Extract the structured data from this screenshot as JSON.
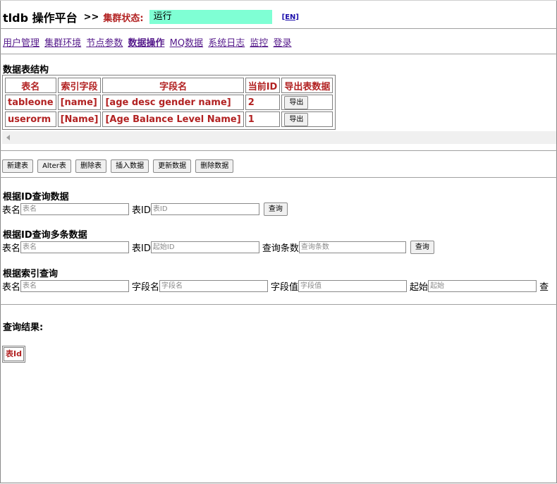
{
  "header": {
    "brand": "tldb 操作平台",
    "separator": ">>",
    "status_label": "集群状态:",
    "status_value": "运行",
    "lang_link": "[EN]"
  },
  "nav": {
    "items": [
      {
        "label": "用户管理"
      },
      {
        "label": "集群环境"
      },
      {
        "label": "节点参数"
      },
      {
        "label": "数据操作"
      },
      {
        "label": "MQ数据"
      },
      {
        "label": "系统日志"
      },
      {
        "label": "监控"
      },
      {
        "label": "登录"
      }
    ]
  },
  "structure": {
    "title": "数据表结构",
    "columns": [
      "表名",
      "索引字段",
      "字段名",
      "当前ID",
      "导出表数据"
    ],
    "rows": [
      {
        "table": "tableone",
        "index": "[name]",
        "fields": "[age desc gender name]",
        "current_id": "2",
        "export_label": "导出"
      },
      {
        "table": "userorm",
        "index": "[Name]",
        "fields": "[Age Balance Level Name]",
        "current_id": "1",
        "export_label": "导出"
      }
    ]
  },
  "actions": {
    "new_table": "新建表",
    "alter_table": "Alter表",
    "delete_table": "删除表",
    "insert_data": "插入数据",
    "update_data": "更新数据",
    "delete_data": "删除数据"
  },
  "query_by_id": {
    "title": "根据ID查询数据",
    "table_label": "表名",
    "table_placeholder": "表名",
    "id_label": "表ID",
    "id_placeholder": "表ID",
    "button": "查询"
  },
  "query_multi": {
    "title": "根据ID查询多条数据",
    "table_label": "表名",
    "table_placeholder": "表名",
    "id_label": "表ID",
    "id_placeholder": "起始ID",
    "count_label": "查询条数",
    "count_placeholder": "查询条数",
    "button": "查询"
  },
  "query_index": {
    "title": "根据索引查询",
    "table_label": "表名",
    "table_placeholder": "表名",
    "field_label": "字段名",
    "field_placeholder": "字段名",
    "value_label": "字段值",
    "value_placeholder": "字段值",
    "start_label": "起始",
    "start_placeholder": "起始",
    "tail": "查"
  },
  "result": {
    "title": "查询结果:",
    "column": "表Id"
  }
}
